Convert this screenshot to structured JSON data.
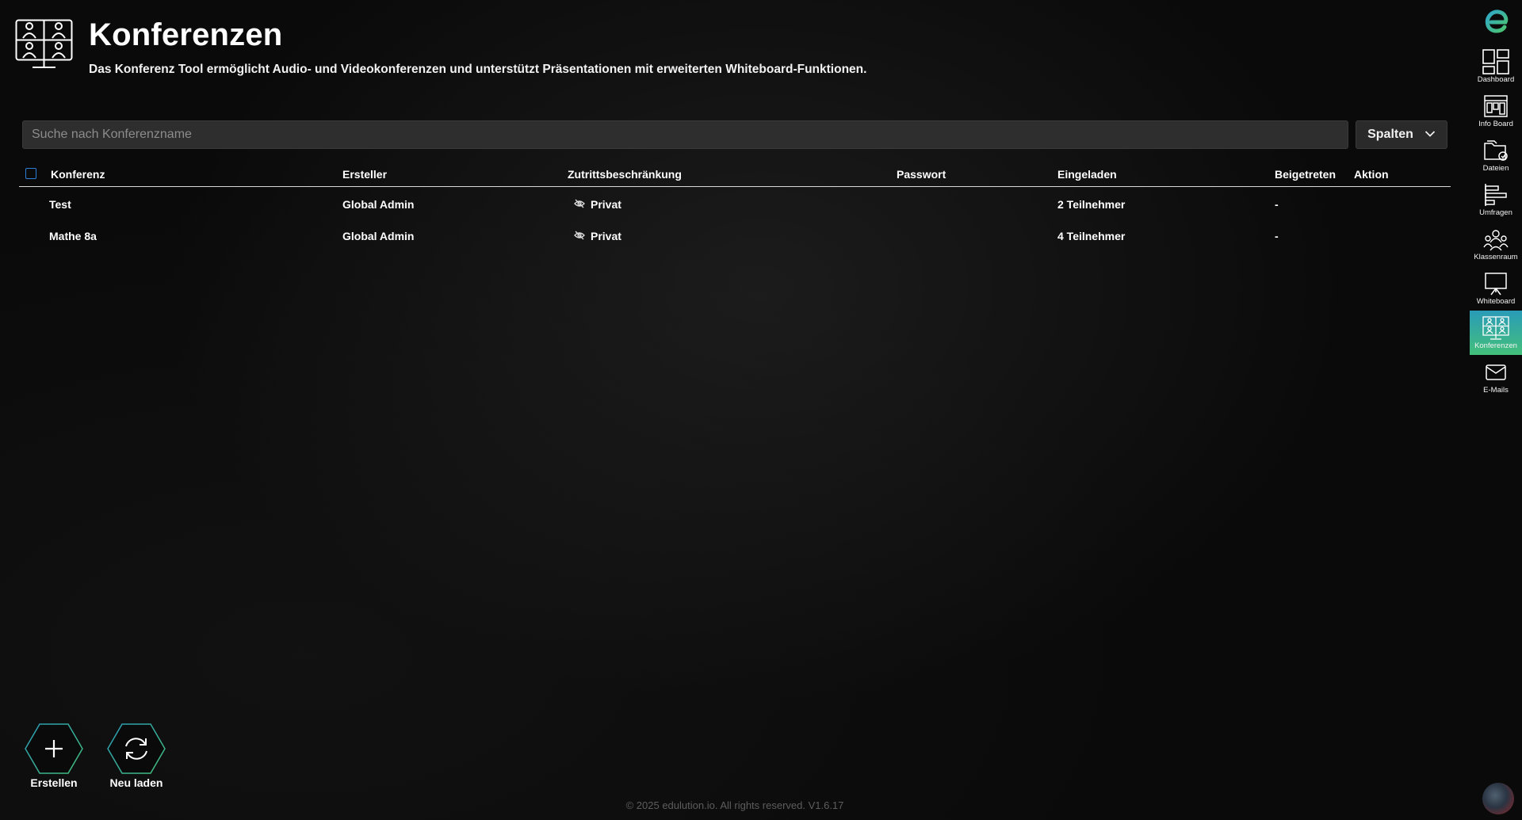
{
  "header": {
    "title": "Konferenzen",
    "subtitle": "Das Konferenz Tool ermöglicht Audio- und Videokonferenzen und unterstützt Präsentationen mit erweiterten Whiteboard-Funktionen.",
    "icon": "conference-icon"
  },
  "search": {
    "placeholder": "Suche nach Konferenzname",
    "value": ""
  },
  "columns_button": {
    "label": "Spalten",
    "icon": "chevron-down-icon"
  },
  "table": {
    "headers": {
      "konferenz": "Konferenz",
      "ersteller": "Ersteller",
      "zutritt": "Zutrittsbeschränkung",
      "passwort": "Passwort",
      "eingeladen": "Eingeladen",
      "beigetreten": "Beigetreten",
      "aktion": "Aktion"
    },
    "rows": [
      {
        "konferenz": "Test",
        "ersteller": "Global Admin",
        "zutritt": "Privat",
        "passwort": "",
        "eingeladen": "2 Teilnehmer",
        "beigetreten": "-"
      },
      {
        "konferenz": "Mathe 8a",
        "ersteller": "Global Admin",
        "zutritt": "Privat",
        "passwort": "",
        "eingeladen": "4 Teilnehmer",
        "beigetreten": "-"
      }
    ]
  },
  "sidebar": {
    "items": [
      {
        "label": "Dashboard",
        "icon": "dashboard-icon"
      },
      {
        "label": "Info Board",
        "icon": "info-board-icon"
      },
      {
        "label": "Dateien",
        "icon": "files-icon"
      },
      {
        "label": "Umfragen",
        "icon": "survey-icon"
      },
      {
        "label": "Klassenraum",
        "icon": "classroom-icon"
      },
      {
        "label": "Whiteboard",
        "icon": "whiteboard-icon"
      },
      {
        "label": "Konferenzen",
        "icon": "conference-icon",
        "active": true
      },
      {
        "label": "E-Mails",
        "icon": "mail-icon"
      }
    ],
    "active_gradient": [
      "#2a9bb8",
      "#43c07a"
    ]
  },
  "actions": {
    "create": {
      "label": "Erstellen",
      "icon": "plus-icon"
    },
    "reload": {
      "label": "Neu laden",
      "icon": "refresh-icon"
    }
  },
  "footer": {
    "text": "© 2025 edulution.io. All rights reserved. V1.6.17"
  }
}
